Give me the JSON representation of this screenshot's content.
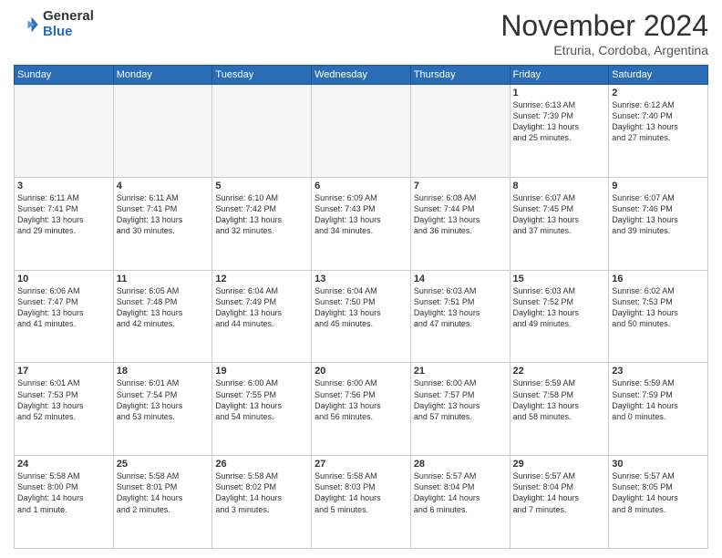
{
  "logo": {
    "general": "General",
    "blue": "Blue"
  },
  "title": "November 2024",
  "location": "Etruria, Cordoba, Argentina",
  "headers": [
    "Sunday",
    "Monday",
    "Tuesday",
    "Wednesday",
    "Thursday",
    "Friday",
    "Saturday"
  ],
  "weeks": [
    [
      {
        "day": "",
        "info": ""
      },
      {
        "day": "",
        "info": ""
      },
      {
        "day": "",
        "info": ""
      },
      {
        "day": "",
        "info": ""
      },
      {
        "day": "",
        "info": ""
      },
      {
        "day": "1",
        "info": "Sunrise: 6:13 AM\nSunset: 7:39 PM\nDaylight: 13 hours\nand 25 minutes."
      },
      {
        "day": "2",
        "info": "Sunrise: 6:12 AM\nSunset: 7:40 PM\nDaylight: 13 hours\nand 27 minutes."
      }
    ],
    [
      {
        "day": "3",
        "info": "Sunrise: 6:11 AM\nSunset: 7:41 PM\nDaylight: 13 hours\nand 29 minutes."
      },
      {
        "day": "4",
        "info": "Sunrise: 6:11 AM\nSunset: 7:41 PM\nDaylight: 13 hours\nand 30 minutes."
      },
      {
        "day": "5",
        "info": "Sunrise: 6:10 AM\nSunset: 7:42 PM\nDaylight: 13 hours\nand 32 minutes."
      },
      {
        "day": "6",
        "info": "Sunrise: 6:09 AM\nSunset: 7:43 PM\nDaylight: 13 hours\nand 34 minutes."
      },
      {
        "day": "7",
        "info": "Sunrise: 6:08 AM\nSunset: 7:44 PM\nDaylight: 13 hours\nand 36 minutes."
      },
      {
        "day": "8",
        "info": "Sunrise: 6:07 AM\nSunset: 7:45 PM\nDaylight: 13 hours\nand 37 minutes."
      },
      {
        "day": "9",
        "info": "Sunrise: 6:07 AM\nSunset: 7:46 PM\nDaylight: 13 hours\nand 39 minutes."
      }
    ],
    [
      {
        "day": "10",
        "info": "Sunrise: 6:06 AM\nSunset: 7:47 PM\nDaylight: 13 hours\nand 41 minutes."
      },
      {
        "day": "11",
        "info": "Sunrise: 6:05 AM\nSunset: 7:48 PM\nDaylight: 13 hours\nand 42 minutes."
      },
      {
        "day": "12",
        "info": "Sunrise: 6:04 AM\nSunset: 7:49 PM\nDaylight: 13 hours\nand 44 minutes."
      },
      {
        "day": "13",
        "info": "Sunrise: 6:04 AM\nSunset: 7:50 PM\nDaylight: 13 hours\nand 45 minutes."
      },
      {
        "day": "14",
        "info": "Sunrise: 6:03 AM\nSunset: 7:51 PM\nDaylight: 13 hours\nand 47 minutes."
      },
      {
        "day": "15",
        "info": "Sunrise: 6:03 AM\nSunset: 7:52 PM\nDaylight: 13 hours\nand 49 minutes."
      },
      {
        "day": "16",
        "info": "Sunrise: 6:02 AM\nSunset: 7:53 PM\nDaylight: 13 hours\nand 50 minutes."
      }
    ],
    [
      {
        "day": "17",
        "info": "Sunrise: 6:01 AM\nSunset: 7:53 PM\nDaylight: 13 hours\nand 52 minutes."
      },
      {
        "day": "18",
        "info": "Sunrise: 6:01 AM\nSunset: 7:54 PM\nDaylight: 13 hours\nand 53 minutes."
      },
      {
        "day": "19",
        "info": "Sunrise: 6:00 AM\nSunset: 7:55 PM\nDaylight: 13 hours\nand 54 minutes."
      },
      {
        "day": "20",
        "info": "Sunrise: 6:00 AM\nSunset: 7:56 PM\nDaylight: 13 hours\nand 56 minutes."
      },
      {
        "day": "21",
        "info": "Sunrise: 6:00 AM\nSunset: 7:57 PM\nDaylight: 13 hours\nand 57 minutes."
      },
      {
        "day": "22",
        "info": "Sunrise: 5:59 AM\nSunset: 7:58 PM\nDaylight: 13 hours\nand 58 minutes."
      },
      {
        "day": "23",
        "info": "Sunrise: 5:59 AM\nSunset: 7:59 PM\nDaylight: 14 hours\nand 0 minutes."
      }
    ],
    [
      {
        "day": "24",
        "info": "Sunrise: 5:58 AM\nSunset: 8:00 PM\nDaylight: 14 hours\nand 1 minute."
      },
      {
        "day": "25",
        "info": "Sunrise: 5:58 AM\nSunset: 8:01 PM\nDaylight: 14 hours\nand 2 minutes."
      },
      {
        "day": "26",
        "info": "Sunrise: 5:58 AM\nSunset: 8:02 PM\nDaylight: 14 hours\nand 3 minutes."
      },
      {
        "day": "27",
        "info": "Sunrise: 5:58 AM\nSunset: 8:03 PM\nDaylight: 14 hours\nand 5 minutes."
      },
      {
        "day": "28",
        "info": "Sunrise: 5:57 AM\nSunset: 8:04 PM\nDaylight: 14 hours\nand 6 minutes."
      },
      {
        "day": "29",
        "info": "Sunrise: 5:57 AM\nSunset: 8:04 PM\nDaylight: 14 hours\nand 7 minutes."
      },
      {
        "day": "30",
        "info": "Sunrise: 5:57 AM\nSunset: 8:05 PM\nDaylight: 14 hours\nand 8 minutes."
      }
    ]
  ]
}
